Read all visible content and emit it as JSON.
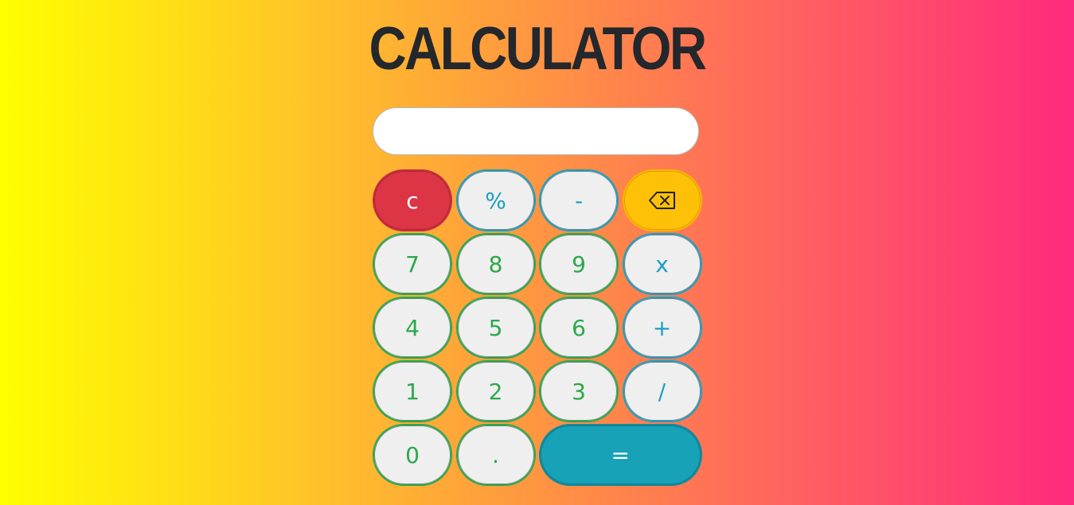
{
  "app": {
    "title": "CALCULATOR"
  },
  "display": {
    "value": "",
    "placeholder": ""
  },
  "keys": {
    "clear": "c",
    "percent": "%",
    "minus": "-",
    "backspace_icon": "backspace-icon",
    "seven": "7",
    "eight": "8",
    "nine": "9",
    "multiply": "x",
    "four": "4",
    "five": "5",
    "six": "6",
    "plus": "+",
    "one": "1",
    "two": "2",
    "three": "3",
    "divide": "/",
    "zero": "0",
    "decimal": ".",
    "equals": "="
  },
  "colors": {
    "gradient_start": "#ffff00",
    "gradient_end": "#ff2a7c",
    "title": "#24272b",
    "digit": "#2aa84a",
    "operator": "#1b9fc0",
    "clear_bg": "#dc3545",
    "backspace_bg": "#ffc107",
    "equals_bg": "#17a2b8",
    "key_bg": "#efefef"
  }
}
